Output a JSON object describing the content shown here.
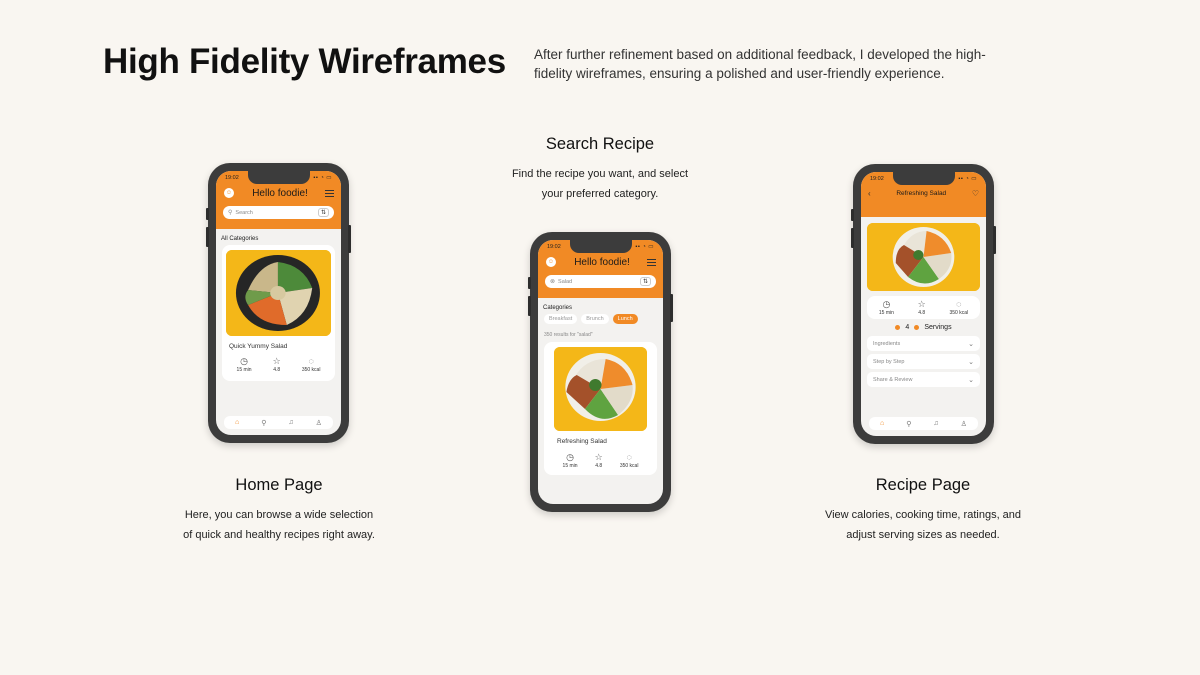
{
  "header": {
    "title": "High Fidelity Wireframes",
    "description": "After further refinement based on additional feedback, I developed the high-fidelity wireframes, ensuring a polished and user-friendly experience."
  },
  "home": {
    "caption_title": "Home Page",
    "caption_text": "Here, you can browse a wide selection of quick and healthy recipes right away.",
    "time": "19:02",
    "greeting": "Hello foodie!",
    "search_placeholder": "Search",
    "section": "All Categories",
    "card_title": "Quick Yummy Salad",
    "stat_time": "15 min",
    "stat_rating": "4.8",
    "stat_kcal": "350 kcal"
  },
  "search": {
    "caption_title": "Search Recipe",
    "caption_text": "Find the recipe you want, and select your preferred category.",
    "time": "19:02",
    "greeting": "Hello foodie!",
    "search_value": "Salad",
    "section": "Categories",
    "chips": [
      "Breakfast",
      "Brunch",
      "Lunch"
    ],
    "results": "350 results for \"salad\"",
    "card_title": "Refreshing Salad",
    "stat_time": "15 min",
    "stat_rating": "4.8",
    "stat_kcal": "350 kcal"
  },
  "recipe": {
    "caption_title": "Recipe Page",
    "caption_text": "View calories, cooking time, ratings, and adjust serving sizes as needed.",
    "time": "19:02",
    "page_title": "Refreshing Salad",
    "stat_time": "15 min",
    "stat_rating": "4.8",
    "stat_kcal": "350 kcal",
    "servings_count": "4",
    "servings_label": "Servings",
    "sections": [
      "Ingredients",
      "Step by Step",
      "Share & Review"
    ]
  },
  "colors": {
    "accent": "#f18a25",
    "background": "#f9f6f1",
    "food_bg": "#f4b718"
  }
}
